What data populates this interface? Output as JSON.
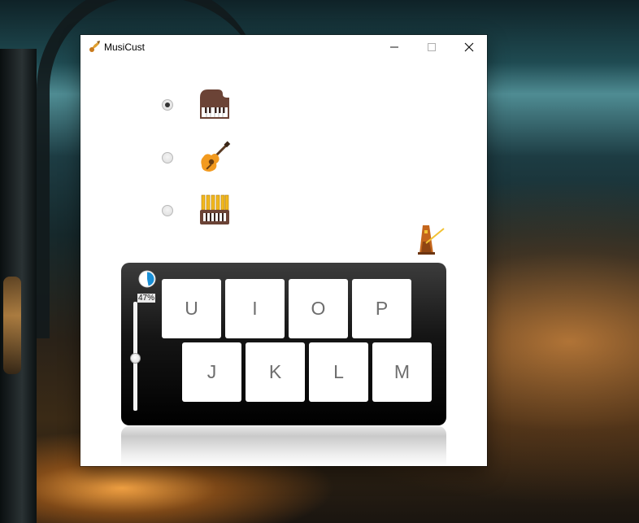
{
  "window": {
    "title": "MusiCust",
    "controls": {
      "minimize_icon": "minimize-icon",
      "maximize_icon": "maximize-icon",
      "close_icon": "close-icon"
    }
  },
  "instruments": [
    {
      "icon": "piano-icon",
      "selected": true
    },
    {
      "icon": "guitar-icon",
      "selected": false
    },
    {
      "icon": "accordion-icon",
      "selected": false
    }
  ],
  "metronome": {
    "icon": "metronome-icon"
  },
  "keyboard": {
    "volume": {
      "percent_label": "47%",
      "value": 0.47
    },
    "rows": [
      [
        "U",
        "I",
        "O",
        "P"
      ],
      [
        "J",
        "K",
        "L",
        "M"
      ]
    ]
  },
  "colors": {
    "panel": "#000000",
    "pie_fill": "#1a8fd6",
    "key_text": "#6e6e6e"
  }
}
